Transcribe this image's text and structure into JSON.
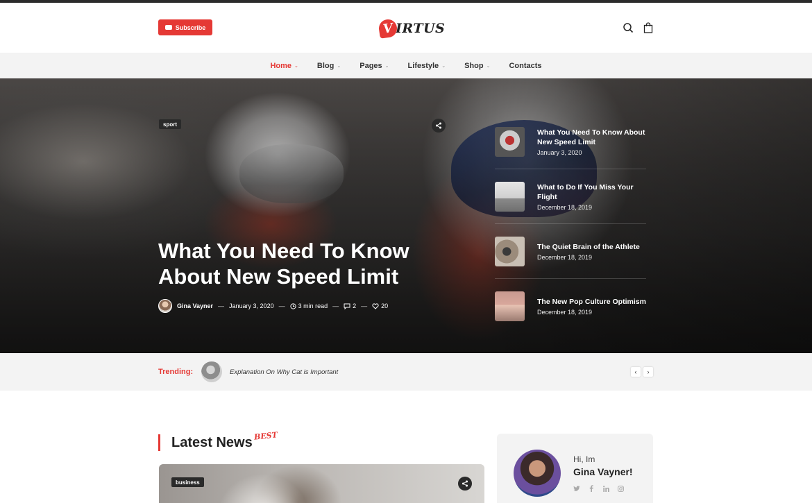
{
  "header": {
    "subscribe_label": "Subscribe",
    "logo_letter": "V",
    "logo_rest": "IRTUS",
    "icons": [
      "search-icon",
      "bag-icon"
    ]
  },
  "nav": {
    "items": [
      {
        "label": "Home",
        "active": true,
        "has_dropdown": true
      },
      {
        "label": "Blog",
        "has_dropdown": true
      },
      {
        "label": "Pages",
        "has_dropdown": true
      },
      {
        "label": "Lifestyle",
        "has_dropdown": true
      },
      {
        "label": "Shop",
        "has_dropdown": true
      },
      {
        "label": "Contacts",
        "has_dropdown": false
      }
    ]
  },
  "hero": {
    "tag": "sport",
    "title": "What You Need To Know About New Speed Limit",
    "author": "Gina Vayner",
    "date": "January 3, 2020",
    "read_time": "3 min read",
    "comments": "2",
    "likes": "20",
    "side_posts": [
      {
        "title": "What You Need To Know About New Speed Limit",
        "date": "January 3, 2020"
      },
      {
        "title": "What to Do If You Miss Your Flight",
        "date": "December 18, 2019"
      },
      {
        "title": "The Quiet Brain of the Athlete",
        "date": "December 18, 2019"
      },
      {
        "title": "The New Pop Culture Optimism",
        "date": "December 18, 2019"
      }
    ]
  },
  "trending": {
    "label": "Trending:",
    "text": "Explanation On Why Cat is Important"
  },
  "latest": {
    "title": "Latest News",
    "badge": "BEST",
    "card_tag": "business"
  },
  "about": {
    "hi": "Hi, Im",
    "name": "Gina Vayner!",
    "social": [
      "twitter-icon",
      "facebook-icon",
      "linkedin-icon",
      "instagram-icon"
    ]
  },
  "colors": {
    "accent": "#e53935",
    "dark": "#222222",
    "light_bg": "#f3f3f3"
  }
}
